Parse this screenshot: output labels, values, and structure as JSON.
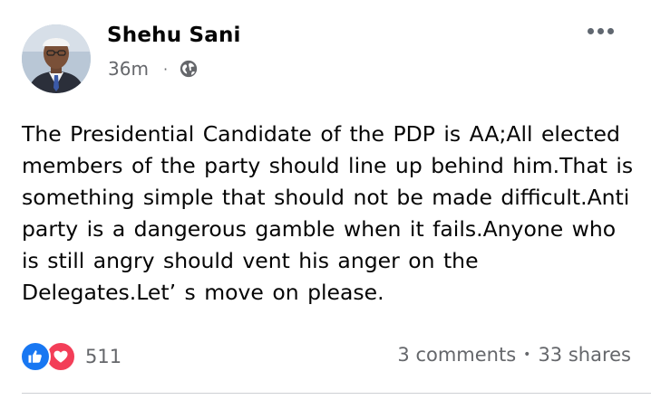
{
  "post": {
    "author": "Shehu Sani",
    "timestamp": "36m",
    "separator": "·",
    "privacy_icon": "globe-icon",
    "more_icon": "ellipsis-icon",
    "text": "The Presidential Candidate of the PDP is AA;All elected\nmembers of the party should line up behind him.That is\nsomething simple that should not be made difficult.Anti\nparty is a dangerous gamble when it fails.Anyone who\nis still angry should vent his anger on the\nDelegates.Let’ s move on please.",
    "reactions": {
      "icons": [
        "like-icon",
        "love-icon"
      ],
      "count": "511"
    },
    "comments": "3 comments",
    "stat_separator": "•",
    "shares": "33 shares"
  },
  "colors": {
    "text": "#050505",
    "secondary": "#65676b",
    "like": "#1877f2",
    "love": "#f33e58"
  }
}
